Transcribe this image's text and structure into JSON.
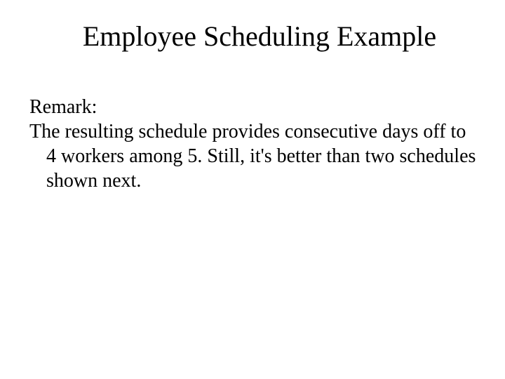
{
  "slide": {
    "title": "Employee Scheduling Example",
    "remark_label": "Remark:",
    "remark_body": "The resulting schedule provides consecutive days off to 4 workers among 5. Still, it's better than two schedules shown next."
  }
}
